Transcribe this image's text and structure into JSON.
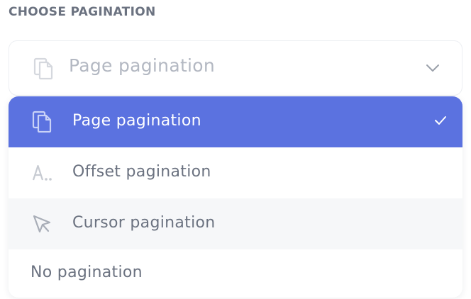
{
  "header": {
    "label": "CHOOSE PAGINATION"
  },
  "select": {
    "value": "Page pagination",
    "icon": "copy-pages-icon",
    "chevron": "chevron-down-icon"
  },
  "dropdown": {
    "options": [
      {
        "label": "Page pagination",
        "icon": "copy-pages-icon",
        "selected": true
      },
      {
        "label": "Offset pagination",
        "icon": "letters-offset-icon",
        "selected": false
      },
      {
        "label": "Cursor pagination",
        "icon": "cursor-pointer-icon",
        "selected": false
      },
      {
        "label": "No pagination",
        "icon": "",
        "selected": false
      }
    ]
  },
  "colors": {
    "accent": "#5b72e0",
    "text_muted": "#6b7280",
    "placeholder": "#b3b8c2",
    "hover_bg": "#f6f7f9"
  }
}
